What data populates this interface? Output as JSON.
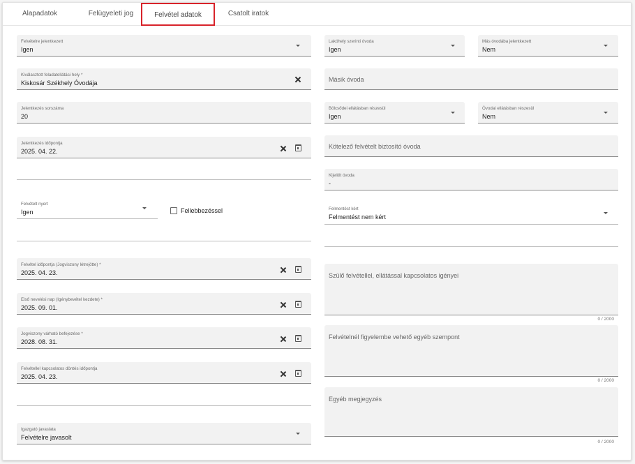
{
  "tabs": [
    {
      "label": "Alapadatok",
      "active": false
    },
    {
      "label": "Felügyeleti jog",
      "active": false
    },
    {
      "label": "Felvétel adatok",
      "active": true
    },
    {
      "label": "Csatolt iratok",
      "active": false
    }
  ],
  "colors": {
    "active_tab_outline": "#d8232a",
    "field_bg": "#f2f2f2"
  },
  "left": {
    "felvetelre_jelentkezett": {
      "label": "Felvételre jelentkezett",
      "value": "Igen"
    },
    "feladatellatasi_hely": {
      "label": "Kiválasztott feladatellátási hely *",
      "value": "Kiskosár Székhely Óvodája"
    },
    "jelentkezes_sorszama": {
      "label": "Jelentkezés sorszáma",
      "value": "20"
    },
    "jelentkezes_idopontja": {
      "label": "Jelentkezés időpontja",
      "value": "2025. 04. 22."
    },
    "felvetelt_nyert": {
      "label": "Felvételt nyert",
      "value": "Igen"
    },
    "fellebbezessel": {
      "label": "Fellebbezéssel",
      "checked": false
    },
    "felvetel_idopontja": {
      "label": "Felvétel időpontja (Jogviszony létrejötte) *",
      "value": "2025. 04. 23."
    },
    "elso_nevelesi_nap": {
      "label": "Első nevelési nap (Igénybevétel kezdete) *",
      "value": "2025. 09. 01."
    },
    "jogviszony_befejezese": {
      "label": "Jogviszony várható befejezése *",
      "value": "2028. 08. 31."
    },
    "dontes_idopontja": {
      "label": "Felvétellel kapcsolatos döntés időpontja",
      "value": "2025. 04. 23."
    },
    "igazgato_javaslata": {
      "label": "Igazgató javaslata",
      "value": "Felvételre javasolt"
    }
  },
  "right": {
    "lakohely_ovoda": {
      "label": "Lakóhely szerinti óvoda",
      "value": "Igen"
    },
    "mas_ovodaba": {
      "label": "Más óvodába jelentkezett",
      "value": "Nem"
    },
    "masik_ovoda": {
      "placeholder": "Másik óvoda"
    },
    "bolcsodei": {
      "label": "Bölcsődei ellátásban részesül",
      "value": "Igen"
    },
    "ovodai": {
      "label": "Óvodai ellátásban részesül",
      "value": "Nem"
    },
    "kotelezo_ovoda": {
      "placeholder": "Kötelező felvételt biztosító óvoda"
    },
    "kijelolt_ovoda": {
      "label": "Kijelölt óvoda",
      "value": "-"
    },
    "felmentest_kert": {
      "label": "Felmentést kért",
      "value": "Felmentést nem kért"
    },
    "szulo_igenyei": {
      "placeholder": "Szülő felvétellel, ellátással kapcsolatos igényei",
      "counter": "0 / 2000"
    },
    "egyeb_szempont": {
      "placeholder": "Felvételnél figyelembe vehető egyéb szempont",
      "counter": "0 / 2000"
    },
    "egyeb_megjegyzes": {
      "placeholder": "Egyéb megjegyzés",
      "counter": "0 / 2000"
    }
  },
  "icons": {
    "dropdown": "caret-down-icon",
    "clear": "close-icon",
    "date": "calendar-icon",
    "checkbox": "checkbox-icon"
  }
}
